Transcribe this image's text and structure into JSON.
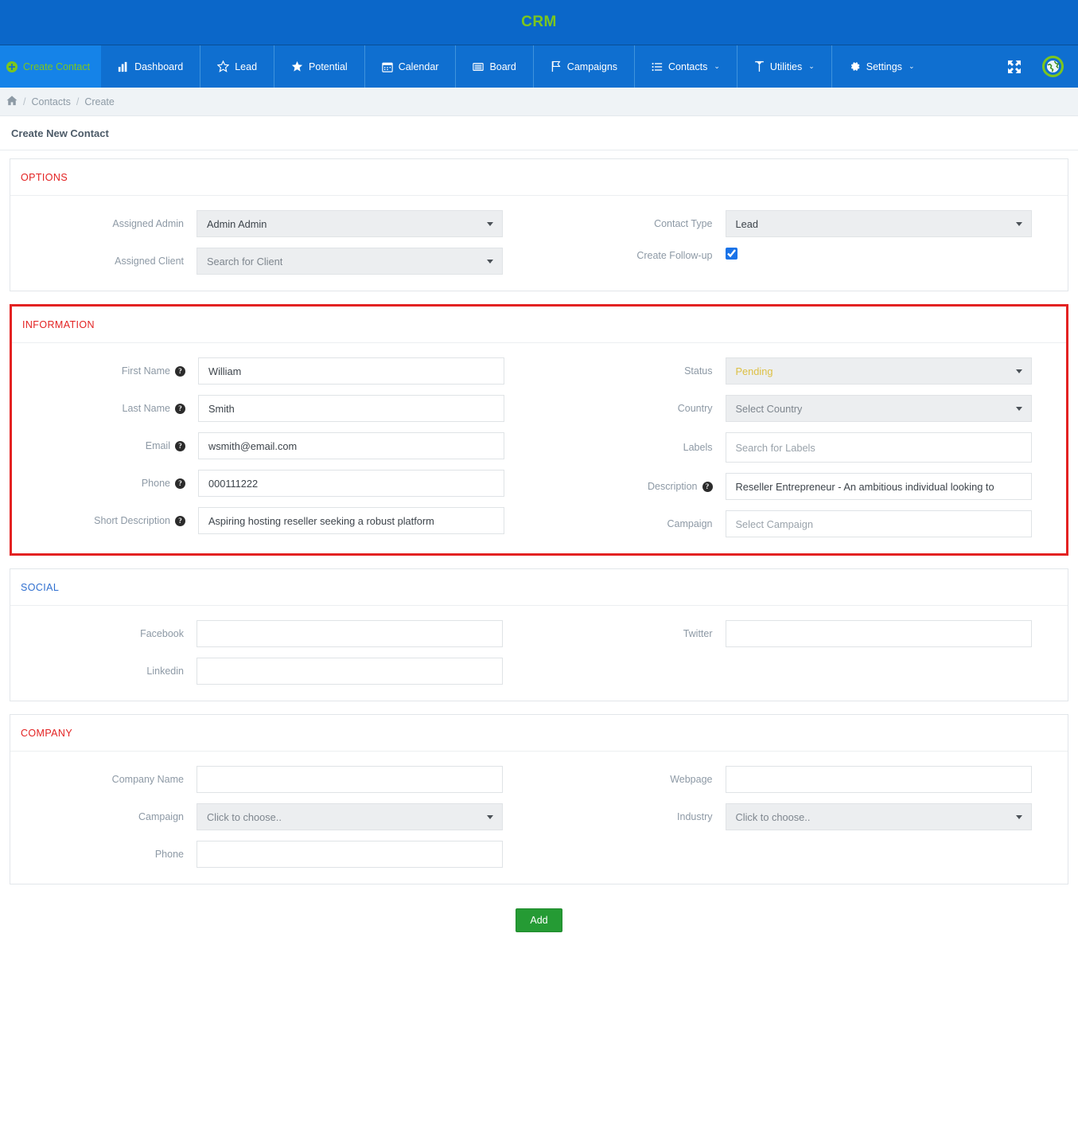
{
  "brand": {
    "title": "CRM"
  },
  "nav": {
    "create_contact": {
      "label": "Create Contact",
      "icon": "plus-circle-icon"
    },
    "items": [
      {
        "label": "Dashboard",
        "icon": "bar-chart-icon",
        "caret": false
      },
      {
        "label": "Lead",
        "icon": "star-outline-icon",
        "caret": false
      },
      {
        "label": "Potential",
        "icon": "star-filled-icon",
        "caret": false
      },
      {
        "label": "Calendar",
        "icon": "calendar-icon",
        "caret": false
      },
      {
        "label": "Board",
        "icon": "board-icon",
        "caret": false
      },
      {
        "label": "Campaigns",
        "icon": "flag-icon",
        "caret": false
      },
      {
        "label": "Contacts",
        "icon": "list-icon",
        "caret": true
      },
      {
        "label": "Utilities",
        "icon": "map-pin-icon",
        "caret": true
      },
      {
        "label": "Settings",
        "icon": "gear-icon",
        "caret": true
      }
    ],
    "fullscreen_label": "Fullscreen",
    "language_label": "Language",
    "caret_glyph": "⌄"
  },
  "breadcrumb": {
    "home_icon": "home-icon",
    "separator": "/",
    "items": [
      "Contacts",
      "Create"
    ]
  },
  "page": {
    "title": "Create New Contact"
  },
  "options": {
    "heading": "OPTIONS",
    "assigned_admin": {
      "label": "Assigned Admin",
      "value": "Admin Admin"
    },
    "assigned_client": {
      "label": "Assigned Client",
      "value": "Search for Client"
    },
    "contact_type": {
      "label": "Contact Type",
      "value": "Lead"
    },
    "create_followup": {
      "label": "Create Follow-up",
      "checked": true
    }
  },
  "information": {
    "heading": "INFORMATION",
    "help_glyph": "?",
    "first_name": {
      "label": "First Name",
      "value": "William",
      "placeholder": ""
    },
    "last_name": {
      "label": "Last Name",
      "value": "Smith",
      "placeholder": ""
    },
    "email": {
      "label": "Email",
      "value": "wsmith@email.com",
      "placeholder": ""
    },
    "phone": {
      "label": "Phone",
      "value": "000111222",
      "placeholder": ""
    },
    "short_description": {
      "label": "Short Description",
      "value": "Aspiring hosting reseller seeking a robust platform",
      "placeholder": ""
    },
    "status": {
      "label": "Status",
      "value": "Pending"
    },
    "country": {
      "label": "Country",
      "value": "Select Country"
    },
    "labels": {
      "label": "Labels",
      "value": "",
      "placeholder": "Search for Labels"
    },
    "description": {
      "label": "Description",
      "value": "Reseller Entrepreneur - An ambitious individual looking to",
      "placeholder": ""
    },
    "campaign": {
      "label": "Campaign",
      "value": "",
      "placeholder": "Select Campaign"
    }
  },
  "social": {
    "heading": "SOCIAL",
    "facebook": {
      "label": "Facebook",
      "value": "",
      "placeholder": ""
    },
    "linkedin": {
      "label": "Linkedin",
      "value": "",
      "placeholder": ""
    },
    "twitter": {
      "label": "Twitter",
      "value": "",
      "placeholder": ""
    }
  },
  "company": {
    "heading": "COMPANY",
    "company_name": {
      "label": "Company Name",
      "value": "",
      "placeholder": ""
    },
    "campaign": {
      "label": "Campaign",
      "value": "Click to choose.."
    },
    "phone": {
      "label": "Phone",
      "value": "",
      "placeholder": ""
    },
    "webpage": {
      "label": "Webpage",
      "value": "",
      "placeholder": ""
    },
    "industry": {
      "label": "Industry",
      "value": "Click to choose.."
    }
  },
  "footer": {
    "add_label": "Add"
  },
  "colors": {
    "brand_blue": "#0b67c9",
    "nav_blue": "#0f6fd0",
    "accent_green": "#7cc61e",
    "section_red": "#e32222",
    "section_blue": "#2f6fd0",
    "status_pending": "#ddc045",
    "add_button_green": "#259b34",
    "highlight_border": "#e32222"
  }
}
